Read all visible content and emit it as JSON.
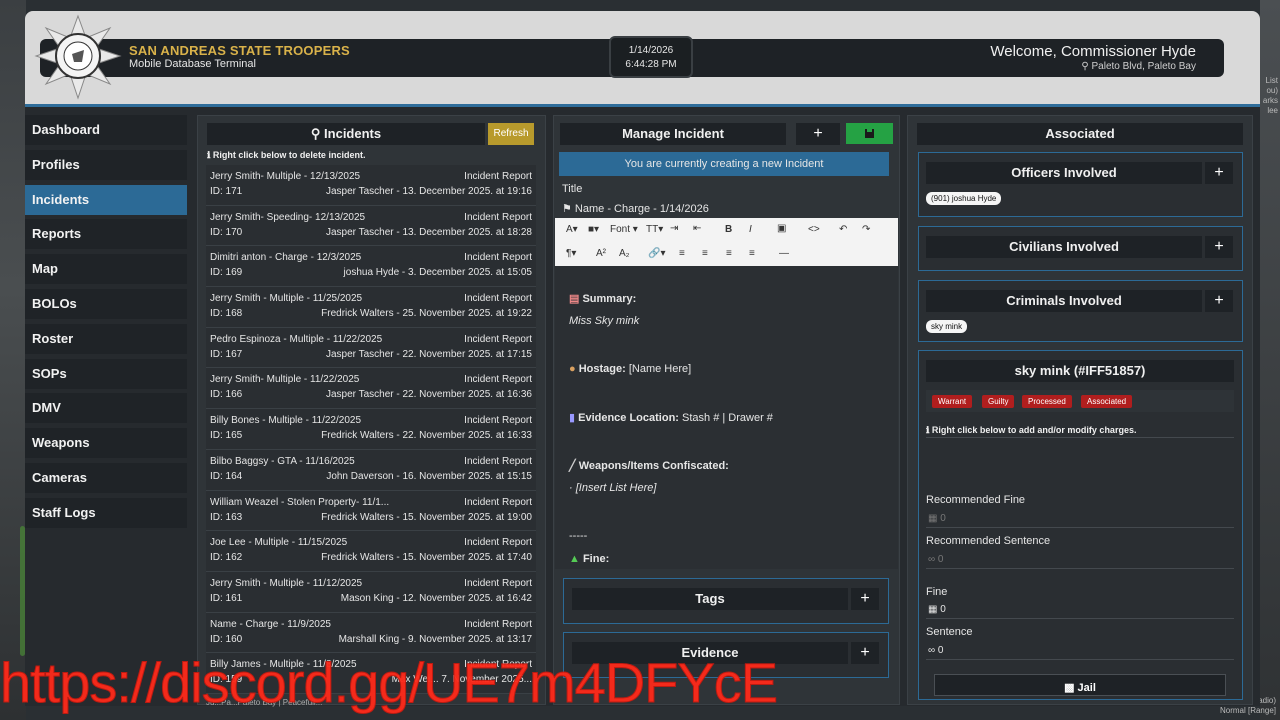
{
  "header": {
    "agency": "SAN ANDREAS STATE TROOPERS",
    "subtitle": "Mobile Database Terminal",
    "date": "1/14/2026",
    "time": "6:44:28 PM",
    "welcome": "Welcome, Commissioner Hyde",
    "location": "Paleto Blvd, Paleto Bay"
  },
  "sidebar": {
    "items": [
      {
        "label": "Dashboard"
      },
      {
        "label": "Profiles"
      },
      {
        "label": "Incidents",
        "active": true
      },
      {
        "label": "Reports"
      },
      {
        "label": "Map"
      },
      {
        "label": "BOLOs"
      },
      {
        "label": "Roster"
      },
      {
        "label": "SOPs"
      },
      {
        "label": "DMV"
      },
      {
        "label": "Weapons"
      },
      {
        "label": "Cameras"
      },
      {
        "label": "Staff Logs"
      }
    ]
  },
  "incidents": {
    "title": "Incidents",
    "refresh_label": "Refresh",
    "hint": "Right click below to delete incident.",
    "items": [
      {
        "title": "Jerry Smith- Multiple - 12/13/2025",
        "type": "Incident Report",
        "id": "ID: 171",
        "meta": "Jasper Tascher - 13. December 2025. at 19:16"
      },
      {
        "title": "Jerry Smith- Speeding- 12/13/2025",
        "type": "Incident Report",
        "id": "ID: 170",
        "meta": "Jasper Tascher - 13. December 2025. at 18:28"
      },
      {
        "title": "Dimitri anton - Charge - 12/3/2025",
        "type": "Incident Report",
        "id": "ID: 169",
        "meta": "joshua Hyde - 3. December 2025. at 15:05"
      },
      {
        "title": "Jerry Smith - Multiple - 11/25/2025",
        "type": "Incident Report",
        "id": "ID: 168",
        "meta": "Fredrick Walters - 25. November 2025. at 19:22"
      },
      {
        "title": "Pedro Espinoza - Multiple - 11/22/2025",
        "type": "Incident Report",
        "id": "ID: 167",
        "meta": "Jasper Tascher - 22. November 2025. at 17:15"
      },
      {
        "title": "Jerry Smith- Multiple - 11/22/2025",
        "type": "Incident Report",
        "id": "ID: 166",
        "meta": "Jasper Tascher - 22. November 2025. at 16:36"
      },
      {
        "title": "Billy Bones - Multiple - 11/22/2025",
        "type": "Incident Report",
        "id": "ID: 165",
        "meta": "Fredrick Walters - 22. November 2025. at 16:33"
      },
      {
        "title": "Bilbo Baggsy - GTA - 11/16/2025",
        "type": "Incident Report",
        "id": "ID: 164",
        "meta": "John Daverson - 16. November 2025. at 15:15"
      },
      {
        "title": "William Weazel - Stolen Property- 11/1...",
        "type": "Incident Report",
        "id": "ID: 163",
        "meta": "Fredrick Walters - 15. November 2025. at 19:00"
      },
      {
        "title": "Joe Lee - Multiple - 11/15/2025",
        "type": "Incident Report",
        "id": "ID: 162",
        "meta": "Fredrick Walters - 15. November 2025. at 17:40"
      },
      {
        "title": "Jerry Smith - Multiple - 11/12/2025",
        "type": "Incident Report",
        "id": "ID: 161",
        "meta": "Mason King - 12. November 2025. at 16:42"
      },
      {
        "title": "Name - Charge - 11/9/2025",
        "type": "Incident Report",
        "id": "ID: 160",
        "meta": "Marshall King - 9. November 2025. at 13:17"
      },
      {
        "title": "Billy James - Multiple - 11/8/2025",
        "type": "Incident Report",
        "id": "ID: 159",
        "meta": "Max Wei... 7. November 2025..."
      }
    ]
  },
  "manage": {
    "title": "Manage Incident",
    "add_symbol": "+",
    "banner": "You are currently creating a new Incident",
    "title_label": "Title",
    "title_value": "Name - Charge - 1/14/2026",
    "toolbar": {
      "font": "Font"
    },
    "editor": {
      "summary_label": "Summary:",
      "summary_text": "Miss Sky mink",
      "hostage_label": "Hostage:",
      "hostage_value": "[Name Here]",
      "evidence_label": "Evidence Location:",
      "evidence_value": "Stash # | Drawer #",
      "weapons_label": "Weapons/Items Confiscated:",
      "weapons_value": "· [Insert List Here]",
      "divider": "-----",
      "fine_label": "Fine:"
    },
    "tags_label": "Tags",
    "evidence_label": "Evidence"
  },
  "associated": {
    "title": "Associated",
    "officers_label": "Officers Involved",
    "officer_chip": "(901) joshua Hyde",
    "civilians_label": "Civilians Involved",
    "criminals_label": "Criminals Involved",
    "criminal_chip": "sky mink",
    "profile_name": "sky mink (#IFF51857)",
    "tags": [
      "Warrant",
      "Guilty",
      "Processed",
      "Associated"
    ],
    "hint": "Right click below to add and/or modify charges.",
    "recommended_fine_label": "Recommended Fine",
    "recommended_fine_value": "0",
    "recommended_sentence_label": "Recommended Sentence",
    "recommended_sentence_value": "0",
    "fine_label": "Fine",
    "fine_value": "0",
    "sentence_label": "Sentence",
    "sentence_value": "0",
    "jail_label": "Jail"
  },
  "overlay": {
    "watermark": "https://discord.gg/UE7m4DFYcE",
    "right_edge_text": [
      "List",
      "ou)",
      "arks",
      "lee"
    ],
    "bottom_right_text": [
      "adio)",
      "Normal [Range]"
    ],
    "bottom_strip": "Ju...Pa...Paleto Bay | Peacefull..."
  },
  "colors": {
    "accent_blue": "#2c6a96",
    "gold": "#d9b24a",
    "save_green": "#25a244",
    "tag_red": "#b01e1e",
    "watermark_red": "#ff2a1a"
  }
}
